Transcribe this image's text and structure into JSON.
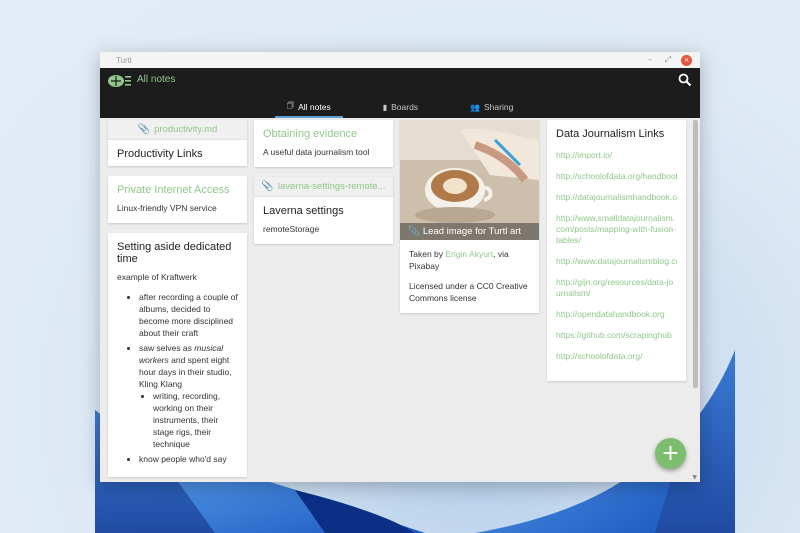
{
  "window": {
    "title": "Turtl",
    "controls": {
      "minimize": "–",
      "maximize": "⤢",
      "close": "×"
    }
  },
  "app": {
    "title": "All notes",
    "tabs": [
      {
        "label": "All notes",
        "icon": "notes-icon",
        "active": true
      },
      {
        "label": "Boards",
        "icon": "boards-icon",
        "active": false
      },
      {
        "label": "Sharing",
        "icon": "sharing-icon",
        "active": false
      }
    ],
    "fab_label": "+"
  },
  "notes": {
    "productivity": {
      "attachment": "productivity.md",
      "title": "Productivity Links"
    },
    "vpn": {
      "title": "Private Internet Access",
      "body": "Linux-friendly VPN service"
    },
    "aside": {
      "title": "Setting aside dedicated time",
      "intro": "example of Kraftwerk",
      "b1": "after recording a couple of albums, decided to become more disciplined about their craft",
      "b2_pre": "saw selves as ",
      "b2_em": "musical workers",
      "b2_post": " and spent eight hour days in their studio, Kling Klang",
      "b2_sub": "writing, recording, working on their instruments, their stage rigs, their technique",
      "b3": "know people who'd say"
    },
    "evidence": {
      "title": "Obtaining evidence",
      "body": "A useful data journalism tool"
    },
    "laverna": {
      "attachment": "laverna-settings-remote...",
      "title": "Laverna settings",
      "body": "remoteStorage"
    },
    "image": {
      "overlay": "Lead image for Turtl art",
      "credit_pre": "Taken by ",
      "credit_name": "Engin Akyurt",
      "credit_post": ", via Pixabay",
      "license": "Licensed under a CC0 Creative Commons license"
    },
    "datajournalism": {
      "title": "Data Journalism Links",
      "links": [
        "http://import.io/",
        "http://schoolofdata.org/handbook",
        "http://datajournalismhandbook.org",
        "http://www.smalldatajournalism.com/posts/mapping-with-fusion-tables/",
        "http://www.datajournalismblog.com",
        "http://gijn.org/resources/data-journalism/",
        "http://opendatahandbook.org",
        "https://github.com/scrapinghub",
        "http://schoolofdata.org/"
      ]
    }
  },
  "colors": {
    "accent": "#8fc88a",
    "appbar": "#1c1c1c",
    "fab": "#7cbd6e",
    "tab_indicator": "#5a9fd4"
  }
}
